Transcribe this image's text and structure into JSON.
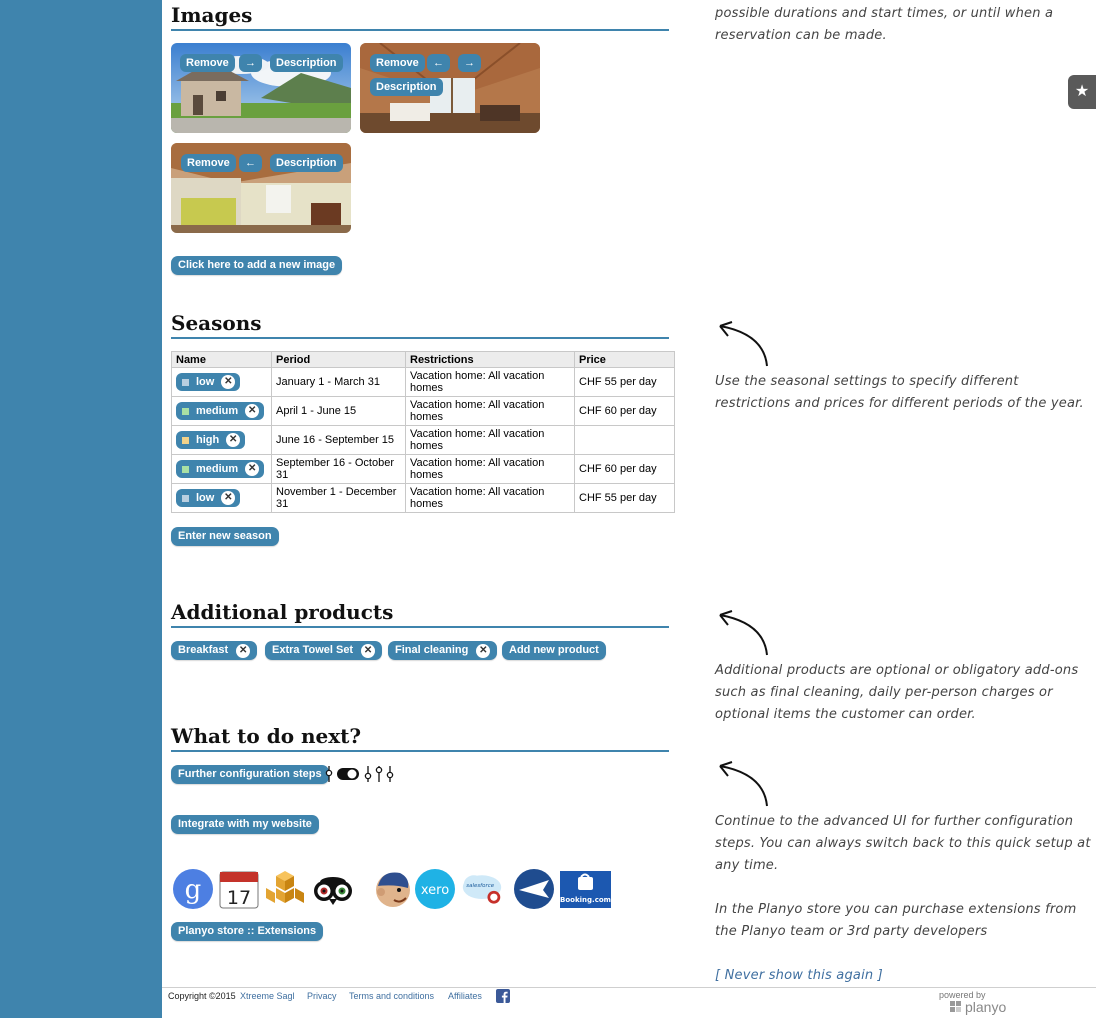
{
  "images": {
    "heading": "Images",
    "tiles": [
      {
        "remove": "Remove",
        "right": "→",
        "description": "Description"
      },
      {
        "remove": "Remove",
        "left": "←",
        "right": "→",
        "description": "Description"
      },
      {
        "remove": "Remove",
        "left": "←",
        "description": "Description"
      }
    ],
    "add_button": "Click here to add a new image"
  },
  "seasons": {
    "heading": "Seasons",
    "columns": [
      "Name",
      "Period",
      "Restrictions",
      "Price"
    ],
    "rows": [
      {
        "name": "low",
        "color": "#b9cfe0",
        "period": "January 1 - March 31",
        "restrictions": "Vacation home: All vacation homes",
        "price": "CHF 55 per day"
      },
      {
        "name": "medium",
        "color": "#a9e0a4",
        "period": "April 1 - June 15",
        "restrictions": "Vacation home: All vacation homes",
        "price": "CHF 60 per day"
      },
      {
        "name": "high",
        "color": "#f1d28a",
        "period": "June 16 - September 15",
        "restrictions": "Vacation home: All vacation homes",
        "price": ""
      },
      {
        "name": "medium",
        "color": "#a9e0a4",
        "period": "September 16 - October 31",
        "restrictions": "Vacation home: All vacation homes",
        "price": "CHF 60 per day"
      },
      {
        "name": "low",
        "color": "#b9cfe0",
        "period": "November 1 - December 31",
        "restrictions": "Vacation home: All vacation homes",
        "price": "CHF 55 per day"
      }
    ],
    "enter_button": "Enter new season"
  },
  "products": {
    "heading": "Additional products",
    "items": [
      "Breakfast",
      "Extra Towel Set",
      "Final cleaning"
    ],
    "add_button": "Add new product",
    "remove_glyph": "✕"
  },
  "next": {
    "heading": "What to do next?",
    "config_button": "Further configuration steps",
    "integrate_button": "Integrate with my website",
    "store_button": "Planyo store :: Extensions",
    "extensions": [
      "google-icon",
      "calendar-icon",
      "aws-icon",
      "tripadvisor-icon",
      "mailchimp-icon",
      "xero-icon",
      "salesforce-icon",
      "expedia-icon",
      "booking-icon"
    ],
    "calendar_day": "17",
    "xero_label": "xero",
    "salesforce_label": "salesforce",
    "booking_label": "Booking.com"
  },
  "hints": {
    "top": "possible durations and start times, or until when a reservation can be made.",
    "seasons": "Use the seasonal settings to specify different restrictions and prices for different periods of the year.",
    "products": "Additional products are optional or obligatory add-ons such as final cleaning, daily per-person charges or optional items the customer can order.",
    "next_1": "Continue to the advanced UI for further configuration steps. You can always switch back to this quick setup at any time.",
    "next_2": "In the Planyo store you can purchase extensions from the Planyo team or 3rd party developers",
    "never_show": "[ Never show this again ]"
  },
  "star_tab": "★",
  "footer": {
    "copyright": "Copyright ©2015",
    "company": "Xtreeme Sagl",
    "privacy": "Privacy",
    "terms": "Terms and conditions",
    "affiliates": "Affiliates",
    "powered_by": "powered by",
    "brand": "planyo"
  }
}
